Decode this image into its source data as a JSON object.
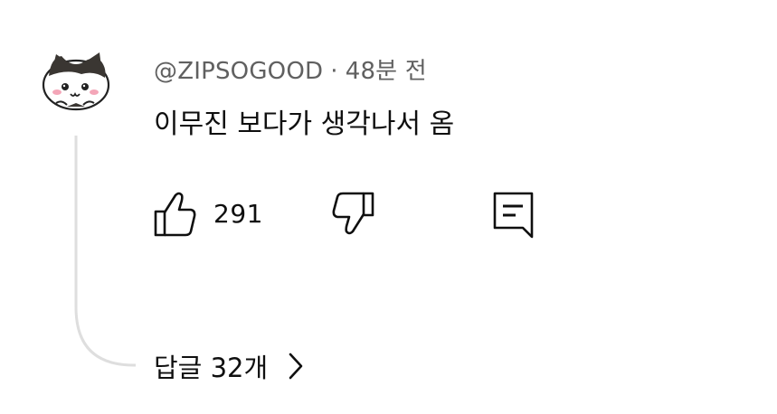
{
  "comment": {
    "author": "@ZIPSOGOOD",
    "separator": "·",
    "time": "48분 전",
    "text": "이무진 보다가 생각나서 옴",
    "avatar_icon": "cat-avatar-icon"
  },
  "actions": {
    "like_icon": "thumbs-up-icon",
    "like_count": "291",
    "dislike_icon": "thumbs-down-icon",
    "reply_icon": "reply-comment-icon"
  },
  "replies": {
    "label": "답글 32개",
    "icon": "chevron-right-icon"
  },
  "colors": {
    "text": "#0f0f0f",
    "secondary": "#606060",
    "thread_line": "#d9d9d9"
  }
}
